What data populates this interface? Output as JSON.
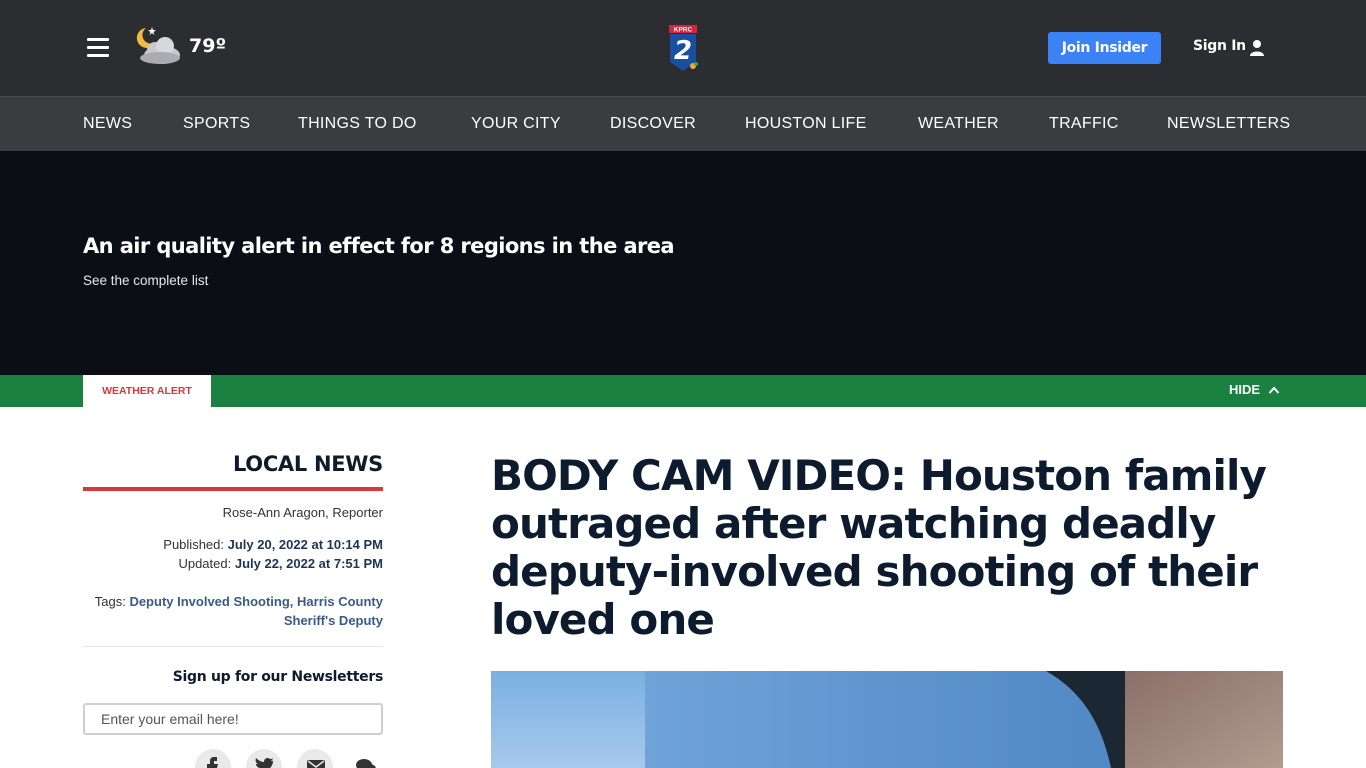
{
  "header": {
    "temperature": "79º",
    "weather_icon": "night-partly-cloudy-icon",
    "logo": "KPRC 2",
    "join_label": "Join Insider",
    "signin_label": "Sign In"
  },
  "nav": {
    "items": [
      {
        "label": "NEWS"
      },
      {
        "label": "SPORTS"
      },
      {
        "label": "THINGS TO DO"
      },
      {
        "label": "YOUR CITY"
      },
      {
        "label": "DISCOVER"
      },
      {
        "label": "HOUSTON LIFE"
      },
      {
        "label": "WEATHER"
      },
      {
        "label": "TRAFFIC"
      },
      {
        "label": "NEWSLETTERS"
      }
    ]
  },
  "alert": {
    "headline": "An air quality alert in effect for 8 regions in the area",
    "subtext": "See the complete list",
    "tab_label": "WEATHER ALERT",
    "hide_label": "HIDE"
  },
  "sidebar": {
    "section": "LOCAL NEWS",
    "author": "Rose-Ann Aragon, Reporter",
    "published_label": "Published:",
    "published_value": "July 20, 2022 at 10:14 PM",
    "updated_label": "Updated:",
    "updated_value": "July 22, 2022 at 7:51 PM",
    "tags_label": "Tags:",
    "tag_1": "Deputy Involved Shooting",
    "tag_2": "Harris County Sheriff's Deputy",
    "newsletter_title": "Sign up for our Newsletters",
    "email_placeholder": "Enter your email here!"
  },
  "article": {
    "headline": "BODY CAM VIDEO: Houston family outraged after watching deadly deputy-involved shooting of their loved one"
  },
  "colors": {
    "header_bg": "#2b2d31",
    "nav_bg": "#3a3c40",
    "alert_bg": "#0b0e14",
    "alert_bar": "#1a8040",
    "accent_red": "#d9383e",
    "join_blue": "#3b82f6"
  }
}
